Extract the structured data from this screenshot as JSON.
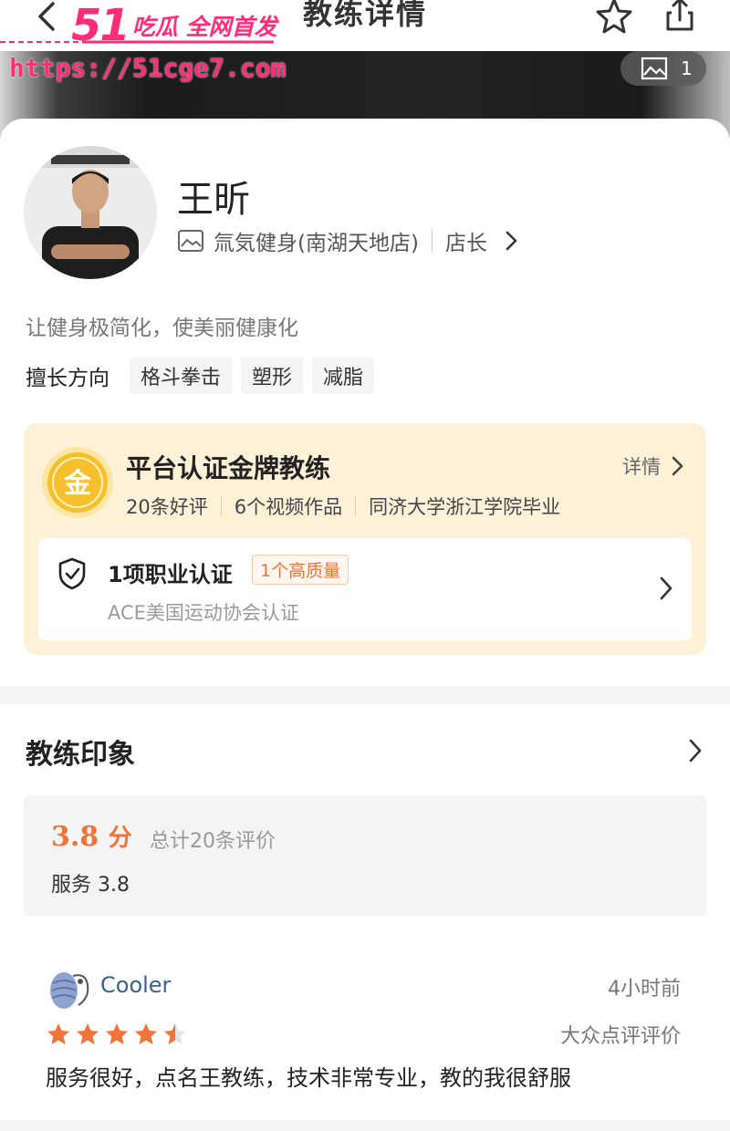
{
  "nav": {
    "title": "教练详情",
    "icons": [
      "back-arrow-icon",
      "star-icon",
      "share-icon"
    ]
  },
  "watermark": {
    "brand_number": "51",
    "brand_text": "吃瓜 全网首发",
    "url": "https://51cge7.com"
  },
  "hero": {
    "photo_count": "1",
    "photo_icon": "image-icon"
  },
  "coach": {
    "name": "王昕",
    "store": "氚気健身(南湖天地店)",
    "role": "店长",
    "slogan": "让健身极简化，使美丽健康化",
    "skills_label": "擅长方向",
    "skills": [
      "格斗拳击",
      "塑形",
      "减脂"
    ]
  },
  "certification": {
    "medal_char": "金",
    "title": "平台认证金牌教练",
    "detail_label": "详情",
    "meta": [
      "20条好评",
      "6个视频作品",
      "同济大学浙江学院毕业"
    ],
    "qualification": {
      "title": "1项职业认证",
      "badge": "1个高质量",
      "subtitle": "ACE美国运动协会认证"
    }
  },
  "impression": {
    "title": "教练印象",
    "score": "3.8",
    "score_unit": "分",
    "total": "总计20条评价",
    "service": "服务 3.8"
  },
  "review": {
    "user": "Cooler",
    "time": "4小时前",
    "rating": 4.5,
    "source": "大众点评评价",
    "text": "服务很好，点名王教练，技术非常专业，教的我很舒服"
  },
  "colors": {
    "accent_orange": "#f0733a",
    "watermark_pink": "#ff2d78",
    "cert_bg": "#fdf2d8",
    "gold": "#f5c02b"
  }
}
